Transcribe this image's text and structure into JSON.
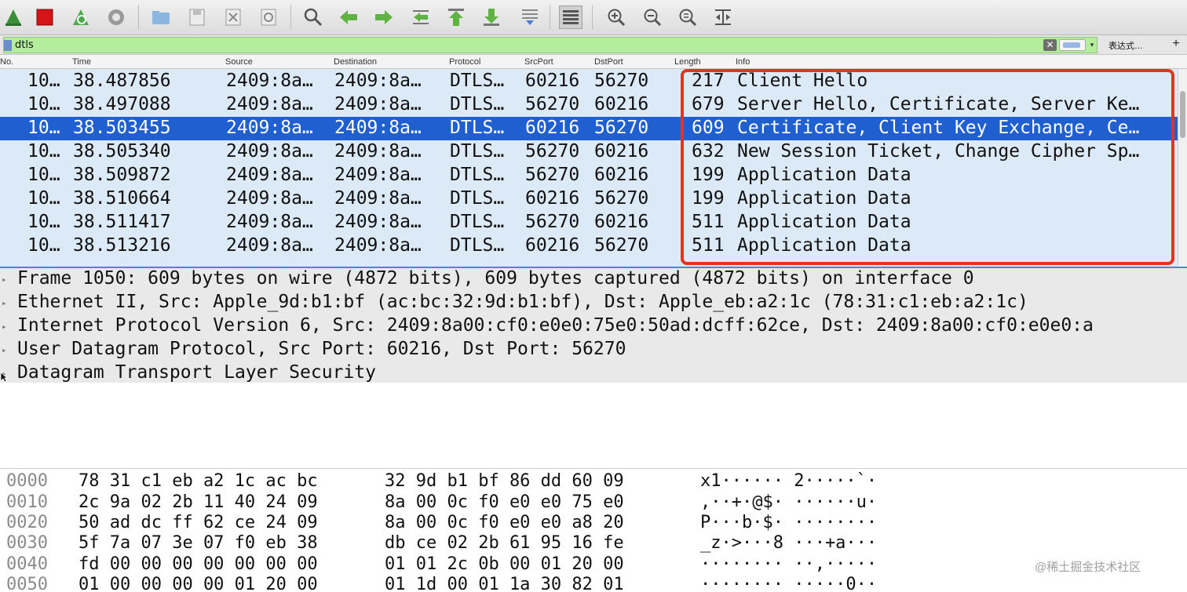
{
  "toolbar": {
    "buttons": [
      {
        "name": "start-capture-icon"
      },
      {
        "name": "stop-capture-icon"
      },
      {
        "name": "restart-capture-icon"
      },
      {
        "name": "capture-options-icon"
      },
      {
        "name": "open-file-icon"
      },
      {
        "name": "save-file-icon"
      },
      {
        "name": "close-file-icon"
      },
      {
        "name": "reload-file-icon"
      },
      {
        "name": "find-packet-icon"
      },
      {
        "name": "go-back-icon"
      },
      {
        "name": "go-forward-icon"
      },
      {
        "name": "go-to-packet-icon"
      },
      {
        "name": "go-first-icon"
      },
      {
        "name": "go-last-icon"
      },
      {
        "name": "auto-scroll-icon"
      },
      {
        "name": "colorize-icon"
      },
      {
        "name": "zoom-in-icon"
      },
      {
        "name": "zoom-out-icon"
      },
      {
        "name": "normal-size-icon"
      },
      {
        "name": "resize-columns-icon"
      }
    ]
  },
  "filter": {
    "value": "dtls",
    "clear_glyph": "✕",
    "dropdown_glyph": "▾",
    "expression_label": "表达式…",
    "add_label": "+"
  },
  "packet_list": {
    "columns": [
      "No.",
      "Time",
      "Source",
      "Destination",
      "Protocol",
      "SrcPort",
      "DstPort",
      "Length",
      "Info"
    ],
    "rows": [
      {
        "no": "10…",
        "time": "38.487856",
        "src": "2409:8a…",
        "dst": "2409:8a…",
        "proto": "DTLS…",
        "srcport": "60216",
        "dstport": "56270",
        "len": "217",
        "info": "Client Hello",
        "selected": false
      },
      {
        "no": "10…",
        "time": "38.497088",
        "src": "2409:8a…",
        "dst": "2409:8a…",
        "proto": "DTLS…",
        "srcport": "56270",
        "dstport": "60216",
        "len": "679",
        "info": "Server Hello, Certificate, Server Ke…",
        "selected": false
      },
      {
        "no": "10…",
        "time": "38.503455",
        "src": "2409:8a…",
        "dst": "2409:8a…",
        "proto": "DTLS…",
        "srcport": "60216",
        "dstport": "56270",
        "len": "609",
        "info": "Certificate, Client Key Exchange, Ce…",
        "selected": true
      },
      {
        "no": "10…",
        "time": "38.505340",
        "src": "2409:8a…",
        "dst": "2409:8a…",
        "proto": "DTLS…",
        "srcport": "56270",
        "dstport": "60216",
        "len": "632",
        "info": "New Session Ticket, Change Cipher Sp…",
        "selected": false
      },
      {
        "no": "10…",
        "time": "38.509872",
        "src": "2409:8a…",
        "dst": "2409:8a…",
        "proto": "DTLS…",
        "srcport": "56270",
        "dstport": "60216",
        "len": "199",
        "info": "Application Data",
        "selected": false
      },
      {
        "no": "10…",
        "time": "38.510664",
        "src": "2409:8a…",
        "dst": "2409:8a…",
        "proto": "DTLS…",
        "srcport": "60216",
        "dstport": "56270",
        "len": "199",
        "info": "Application Data",
        "selected": false
      },
      {
        "no": "10…",
        "time": "38.511417",
        "src": "2409:8a…",
        "dst": "2409:8a…",
        "proto": "DTLS…",
        "srcport": "56270",
        "dstport": "60216",
        "len": "511",
        "info": "Application Data",
        "selected": false
      },
      {
        "no": "10…",
        "time": "38.513216",
        "src": "2409:8a…",
        "dst": "2409:8a…",
        "proto": "DTLS…",
        "srcport": "60216",
        "dstport": "56270",
        "len": "511",
        "info": "Application Data",
        "selected": false
      }
    ]
  },
  "details": {
    "lines": [
      "Frame 1050: 609 bytes on wire (4872 bits), 609 bytes captured (4872 bits) on interface 0",
      "Ethernet II, Src: Apple_9d:b1:bf (ac:bc:32:9d:b1:bf), Dst: Apple_eb:a2:1c (78:31:c1:eb:a2:1c)",
      "Internet Protocol Version 6, Src: 2409:8a00:cf0:e0e0:75e0:50ad:dcff:62ce, Dst: 2409:8a00:cf0:e0e0:a",
      "User Datagram Protocol, Src Port: 60216, Dst Port: 56270",
      "Datagram Transport Layer Security"
    ],
    "expand_glyph": "▸"
  },
  "bytes": {
    "lines": [
      {
        "offset": "0000",
        "hex1": "78 31 c1 eb a2 1c ac bc",
        "hex2": "32 9d b1 bf 86 dd 60 09",
        "ascii": "x1······ 2·····`·"
      },
      {
        "offset": "0010",
        "hex1": "2c 9a 02 2b 11 40 24 09",
        "hex2": "8a 00 0c f0 e0 e0 75 e0",
        "ascii": ",··+·@$· ······u·"
      },
      {
        "offset": "0020",
        "hex1": "50 ad dc ff 62 ce 24 09",
        "hex2": "8a 00 0c f0 e0 e0 a8 20",
        "ascii": "P···b·$· ········"
      },
      {
        "offset": "0030",
        "hex1": "5f 7a 07 3e 07 f0 eb 38",
        "hex2": "db ce 02 2b 61 95 16 fe",
        "ascii": "_z·>···8 ···+a···"
      },
      {
        "offset": "0040",
        "hex1": "fd 00 00 00 00 00 00 00",
        "hex2": "01 01 2c 0b 00 01 20 00",
        "ascii": "········ ··,·····"
      },
      {
        "offset": "0050",
        "hex1": "01 00 00 00 00 01 20 00",
        "hex2": "01 1d 00 01 1a 30 82 01",
        "ascii": "········ ·····0··"
      }
    ]
  },
  "watermark": "@稀土掘金技术社区",
  "colors": {
    "selected_row": "#1f5fd0",
    "row_bg": "#dce9f7",
    "filter_ok": "#b4ed9c",
    "annotation_box": "#e8321f"
  }
}
